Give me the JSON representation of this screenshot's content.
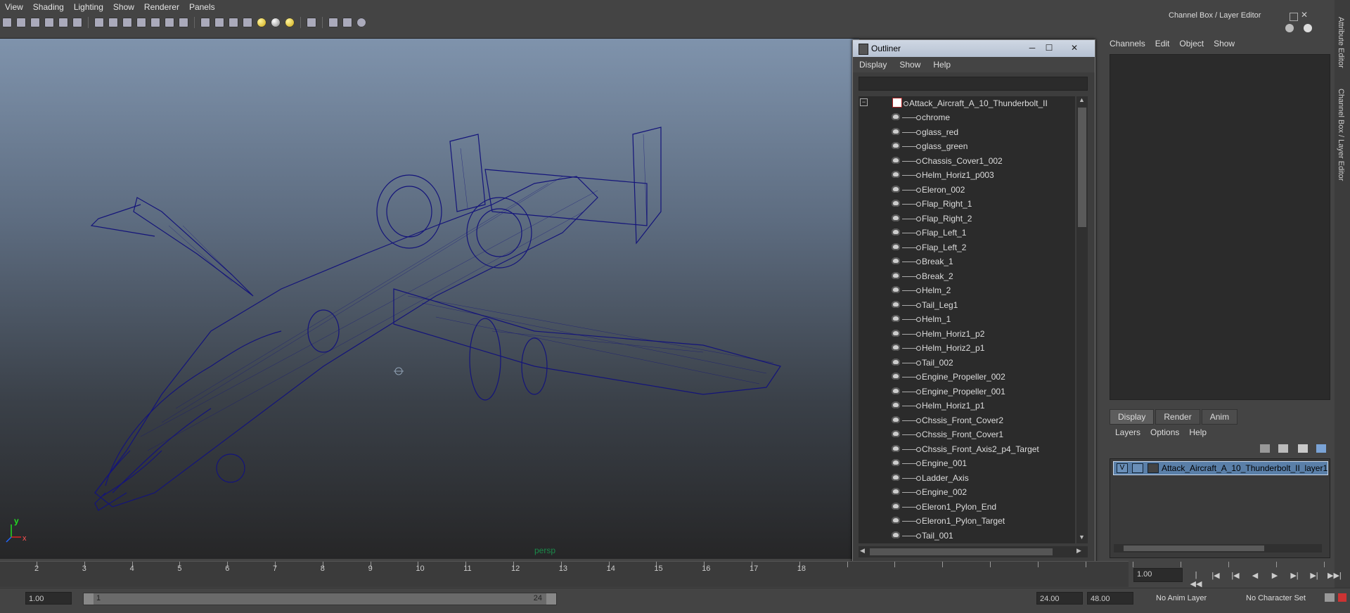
{
  "menubar": [
    "View",
    "Shading",
    "Lighting",
    "Show",
    "Renderer",
    "Panels"
  ],
  "viewport": {
    "camera": "persp",
    "axis_y": "y",
    "axis_x": "x"
  },
  "outliner": {
    "title": "Outliner",
    "menu": [
      "Display",
      "Show",
      "Help"
    ],
    "root": "Attack_Aircraft_A_10_Thunderbolt_II",
    "items": [
      "chrome",
      "glass_red",
      "glass_green",
      "Chassis_Cover1_002",
      "Helm_Horiz1_p003",
      "Eleron_002",
      "Flap_Right_1",
      "Flap_Right_2",
      "Flap_Left_1",
      "Flap_Left_2",
      "Break_1",
      "Break_2",
      "Helm_2",
      "Tail_Leg1",
      "Helm_1",
      "Helm_Horiz1_p2",
      "Helm_Horiz2_p1",
      "Tail_002",
      "Engine_Propeller_002",
      "Engine_Propeller_001",
      "Helm_Horiz1_p1",
      "Chssis_Front_Cover2",
      "Chssis_Front_Cover1",
      "Chssis_Front_Axis2_p4_Target",
      "Engine_001",
      "Ladder_Axis",
      "Engine_002",
      "Eleron1_Pylon_End",
      "Eleron1_Pylon_Target",
      "Tail_001"
    ]
  },
  "channel_box": {
    "title": "Channel Box / Layer Editor",
    "menu": [
      "Channels",
      "Edit",
      "Object",
      "Show"
    ],
    "tabs": [
      "Display",
      "Render",
      "Anim"
    ],
    "layer_menu": [
      "Layers",
      "Options",
      "Help"
    ],
    "layer": {
      "visible": "V",
      "name": "Attack_Aircraft_A_10_Thunderbolt_II_layer1"
    }
  },
  "side_tabs": [
    "Attribute Editor",
    "Channel Box / Layer Editor"
  ],
  "timeline": {
    "ticks": [
      "2",
      "3",
      "4",
      "5",
      "6",
      "7",
      "8",
      "9",
      "10",
      "11",
      "12",
      "13",
      "14",
      "15",
      "16",
      "17",
      "18"
    ],
    "current_frame": "1.00"
  },
  "range": {
    "start": "1.00",
    "slider_start": "1",
    "slider_end": "24",
    "end": "24.00",
    "max": "48.00",
    "anim_layer": "No Anim Layer",
    "char_set": "No Character Set"
  },
  "colors": {
    "wireframe": "#14147a",
    "viewport_top": "#7f93ac",
    "viewport_bottom": "#262627",
    "layer_highlight": "#5a7fa8"
  }
}
